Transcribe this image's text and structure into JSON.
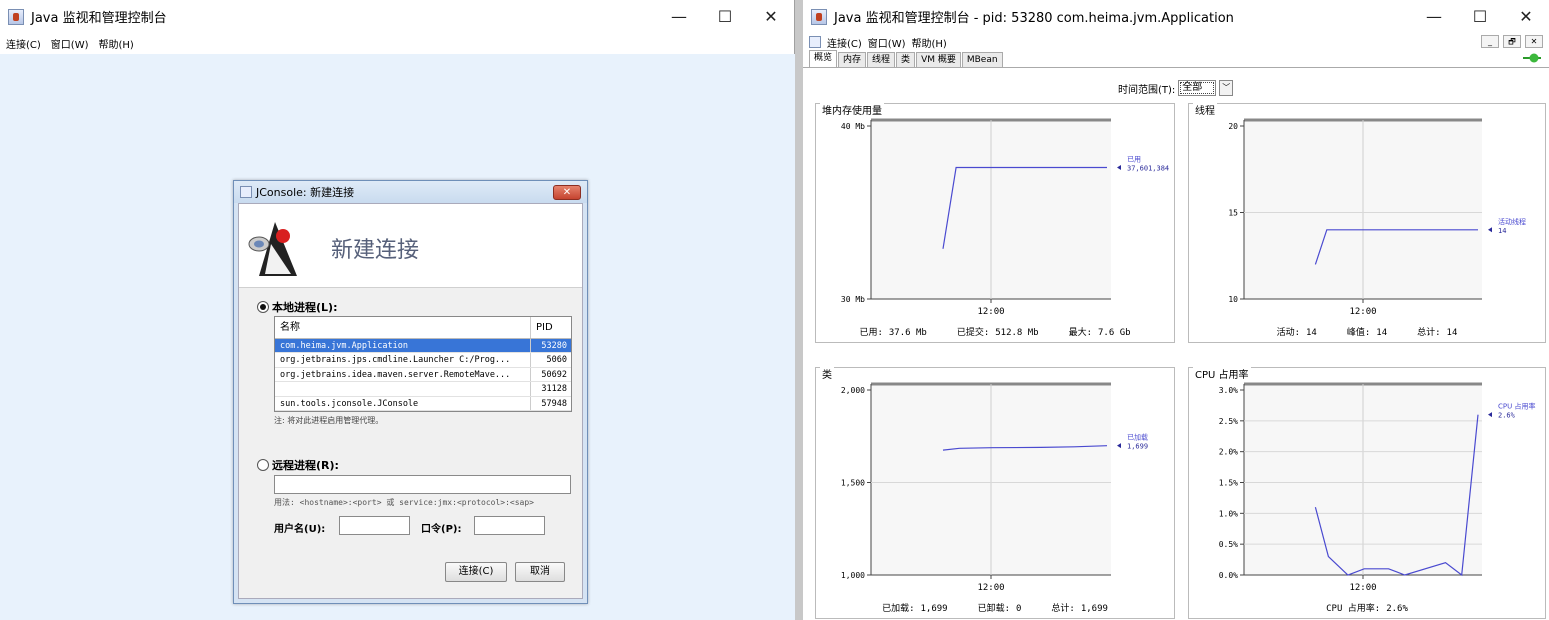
{
  "left_window": {
    "title": "Java 监视和管理控制台",
    "menu": [
      "连接(C)",
      "窗口(W)",
      "帮助(H)"
    ],
    "controls": {
      "minimize": "—",
      "maximize": "☐",
      "close": "✕"
    }
  },
  "dialog": {
    "title": "JConsole: 新建连接",
    "header": "新建连接",
    "local_label": "本地进程(L):",
    "table_headers": {
      "name": "名称",
      "pid": "PID"
    },
    "processes": [
      {
        "name": "com.heima.jvm.Application",
        "pid": "53280",
        "selected": true
      },
      {
        "name": "org.jetbrains.jps.cmdline.Launcher C:/Prog...",
        "pid": "5060"
      },
      {
        "name": "org.jetbrains.idea.maven.server.RemoteMave...",
        "pid": "50692"
      },
      {
        "name": "",
        "pid": "31128"
      },
      {
        "name": "sun.tools.jconsole.JConsole",
        "pid": "57948"
      }
    ],
    "note": "注: 将对此进程启用管理代理。",
    "remote_label": "远程进程(R):",
    "remote_value": "",
    "usage": "用法: <hostname>:<port> 或 service:jmx:<protocol>:<sap>",
    "username_label": "用户名(U):",
    "password_label": "口令(P):",
    "connect_button": "连接(C)",
    "cancel_button": "取消",
    "close_glyph": "✕"
  },
  "right_window": {
    "title": "Java 监视和管理控制台 - pid: 53280 com.heima.jvm.Application",
    "menu": [
      "连接(C)",
      "窗口(W)",
      "帮助(H)"
    ],
    "controls": {
      "minimize": "—",
      "maximize": "☐",
      "close": "✕"
    },
    "mdi_controls": [
      "_",
      "🗗",
      "✕"
    ],
    "tabs": [
      "概览",
      "内存",
      "线程",
      "类",
      "VM 概要",
      "MBean"
    ],
    "active_tab": 0,
    "time_range_label": "时间范围(T):",
    "time_range_value": "全部",
    "dropdown_glyph": "﹀"
  },
  "chart_data": [
    {
      "type": "line",
      "title": "堆内存使用量",
      "y_ticks": [
        "40 Mb",
        "30 Mb"
      ],
      "ylim": [
        30,
        40
      ],
      "x_tick": "12:00",
      "series": [
        {
          "name": "已用",
          "label": "已用",
          "value_label": "37,601,384",
          "points": [
            [
              0,
              32.9
            ],
            [
              0.08,
              37.6
            ],
            [
              1,
              37.6
            ]
          ]
        }
      ],
      "footer": [
        {
          "label": "已用:",
          "value": "37.6  Mb"
        },
        {
          "label": "已提交:",
          "value": "512.8  Mb"
        },
        {
          "label": "最大:",
          "value": "7.6  Gb"
        }
      ]
    },
    {
      "type": "line",
      "title": "线程",
      "y_ticks": [
        "20",
        "15",
        "10"
      ],
      "ylim": [
        10,
        20
      ],
      "x_tick": "12:00",
      "series": [
        {
          "name": "活动线程",
          "label": "活动线程",
          "value_label": "14",
          "points": [
            [
              0,
              12
            ],
            [
              0.07,
              14
            ],
            [
              1,
              14
            ]
          ]
        }
      ],
      "footer": [
        {
          "label": "活动:",
          "value": "14"
        },
        {
          "label": "峰值:",
          "value": "14"
        },
        {
          "label": "总计:",
          "value": "14"
        }
      ]
    },
    {
      "type": "line",
      "title": "类",
      "y_ticks": [
        "2,000",
        "1,500",
        "1,000"
      ],
      "ylim": [
        1000,
        2000
      ],
      "x_tick": "12:00",
      "series": [
        {
          "name": "已加载",
          "label": "已加载",
          "value_label": "1,699",
          "points": [
            [
              0,
              1675
            ],
            [
              0.1,
              1685
            ],
            [
              0.3,
              1688
            ],
            [
              0.6,
              1690
            ],
            [
              0.8,
              1693
            ],
            [
              1,
              1699
            ]
          ]
        }
      ],
      "footer": [
        {
          "label": "已加载:",
          "value": "1,699"
        },
        {
          "label": "已卸载:",
          "value": "0"
        },
        {
          "label": "总计:",
          "value": "1,699"
        }
      ]
    },
    {
      "type": "line",
      "title": "CPU 占用率",
      "y_ticks": [
        "3.0%",
        "2.5%",
        "2.0%",
        "1.5%",
        "1.0%",
        "0.5%",
        "0.0%"
      ],
      "ylim": [
        0,
        3
      ],
      "x_tick": "12:00",
      "series": [
        {
          "name": "CPU 占用率",
          "label": "CPU 占用率",
          "value_label": "2.6%",
          "points": [
            [
              0,
              1.1
            ],
            [
              0.08,
              0.3
            ],
            [
              0.2,
              0.0
            ],
            [
              0.3,
              0.1
            ],
            [
              0.45,
              0.1
            ],
            [
              0.55,
              0.0
            ],
            [
              0.8,
              0.2
            ],
            [
              0.9,
              0.0
            ],
            [
              1,
              2.6
            ]
          ]
        }
      ],
      "footer": [
        {
          "label": "CPU 占用率:",
          "value": "2.6%"
        }
      ]
    }
  ]
}
